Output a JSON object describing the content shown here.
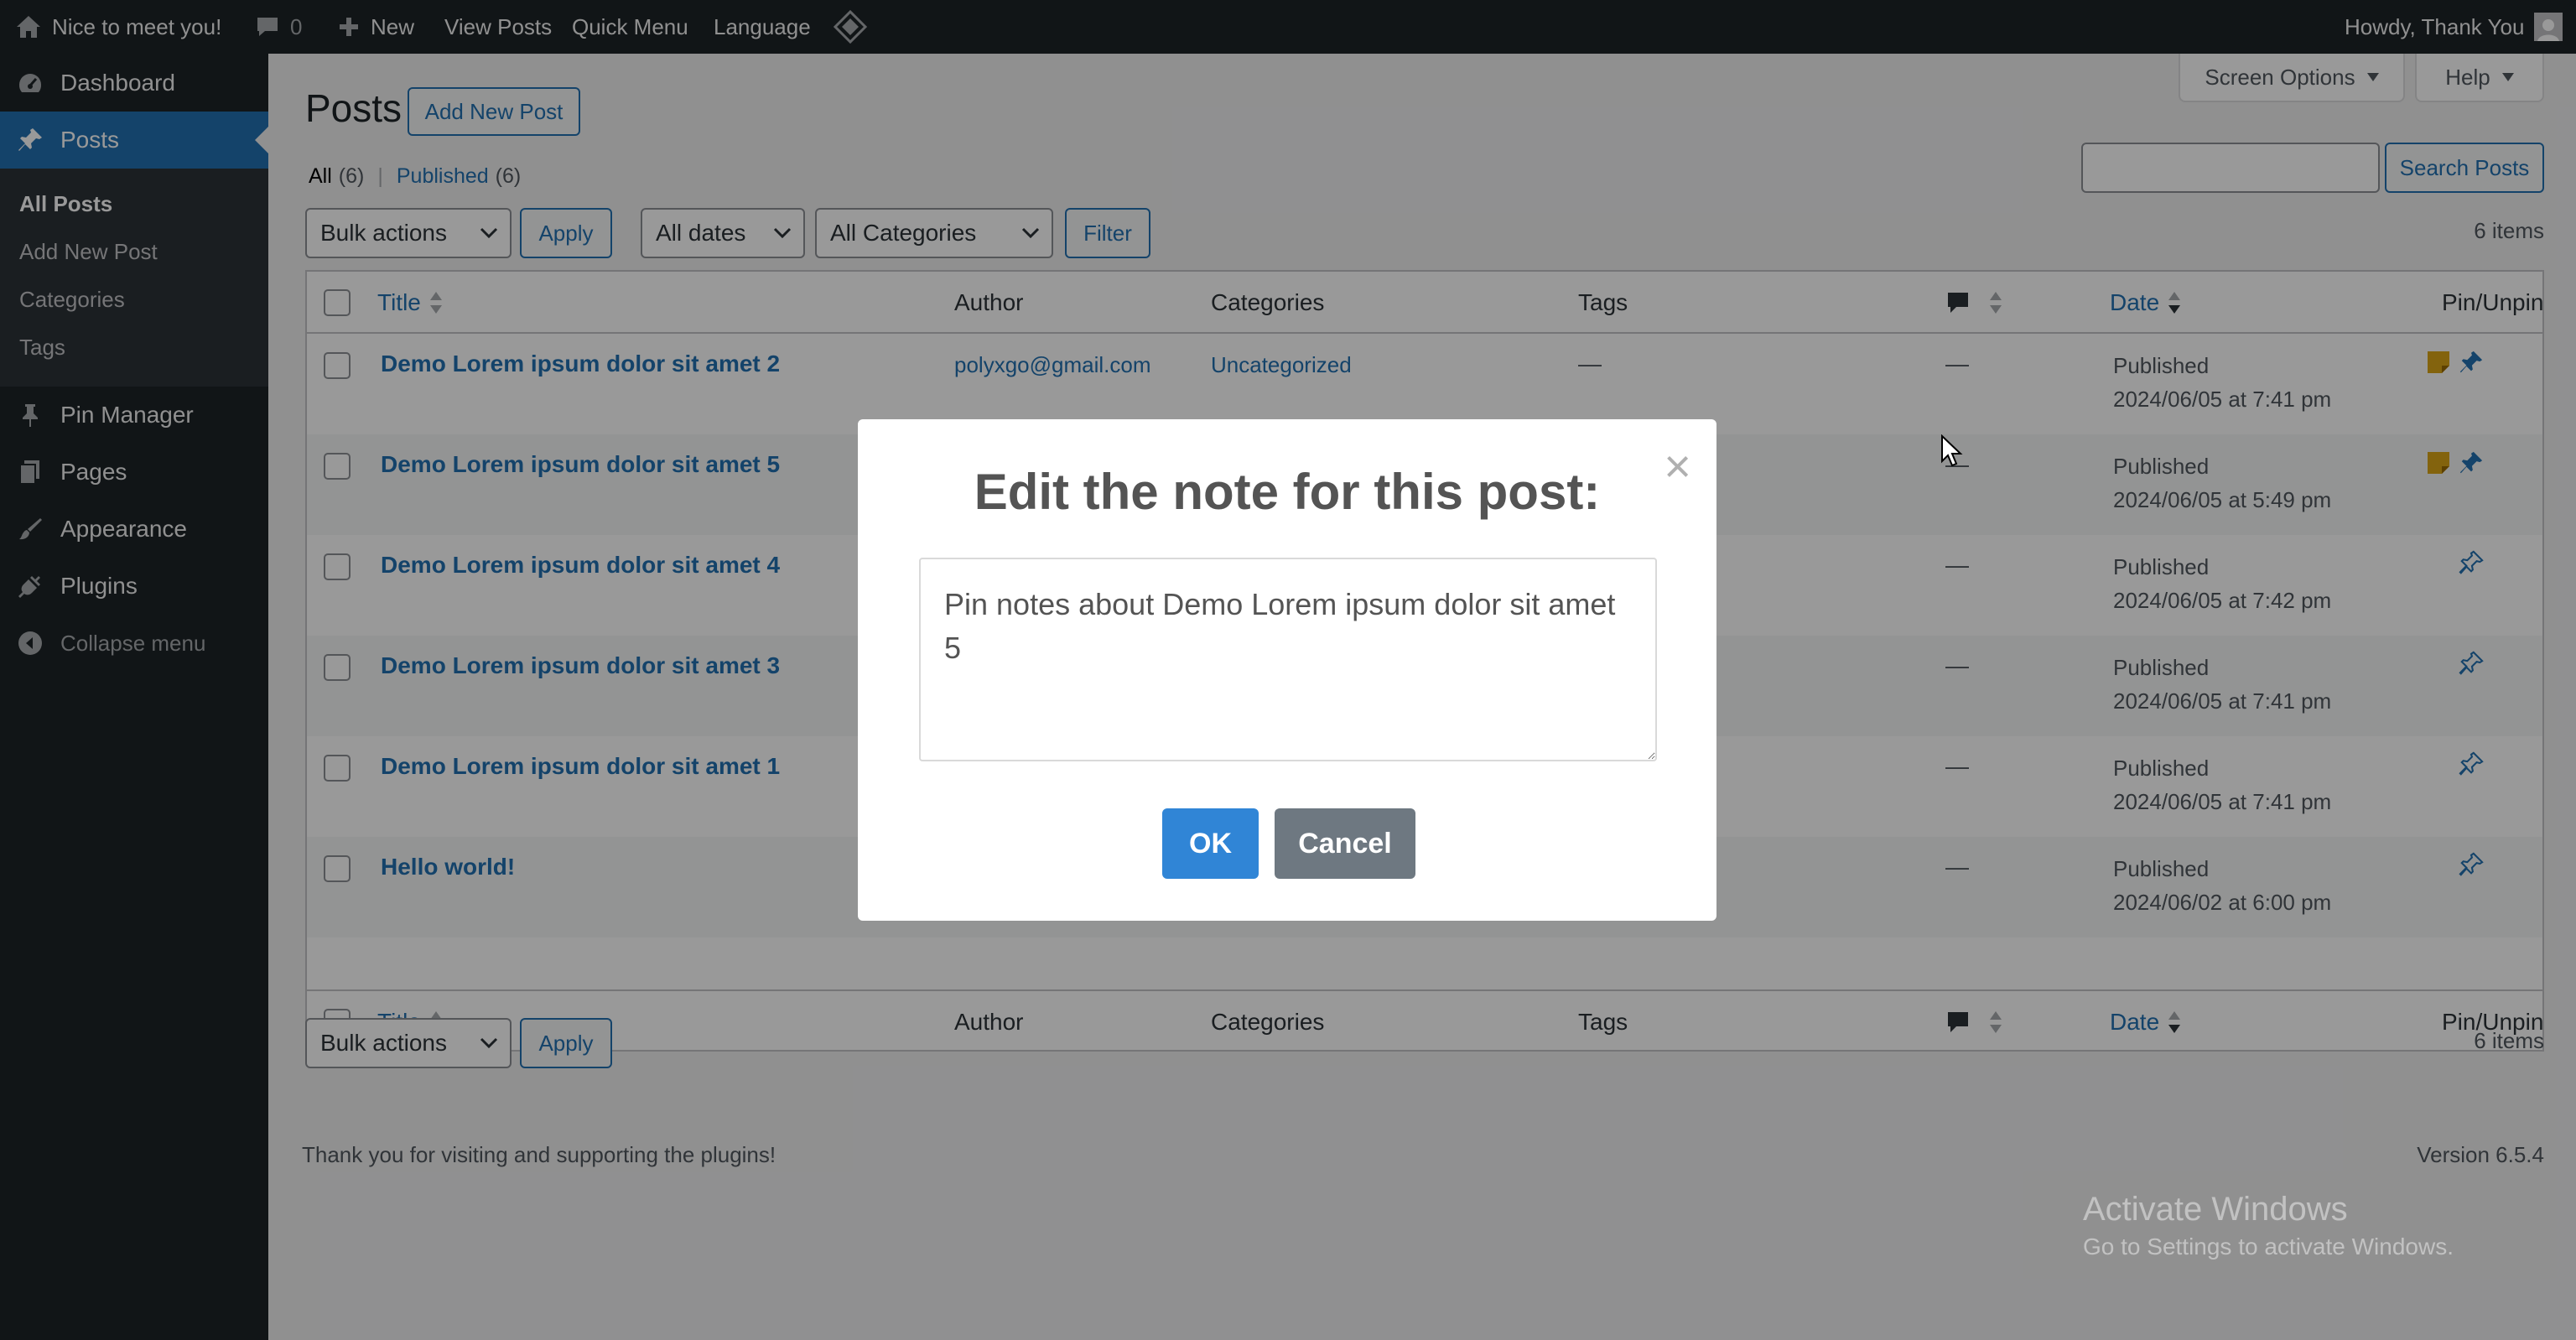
{
  "adminbar": {
    "site_name": "Nice to meet you!",
    "comments_count": "0",
    "new_label": "New",
    "view_posts": "View Posts",
    "quick_menu": "Quick Menu",
    "language": "Language",
    "howdy": "Howdy, Thank You"
  },
  "sidebar": {
    "dashboard": "Dashboard",
    "posts": "Posts",
    "sub": {
      "all_posts": "All Posts",
      "add_new_post": "Add New Post",
      "categories": "Categories",
      "tags": "Tags"
    },
    "pin_manager": "Pin Manager",
    "pages": "Pages",
    "appearance": "Appearance",
    "plugins": "Plugins",
    "collapse": "Collapse menu"
  },
  "header": {
    "title": "Posts",
    "add_new": "Add New Post",
    "screen_options": "Screen Options",
    "help": "Help"
  },
  "filters": {
    "all_label": "All",
    "all_count": "(6)",
    "separator": "|",
    "published_label": "Published",
    "published_count": "(6)",
    "bulk_actions": "Bulk actions",
    "apply": "Apply",
    "all_dates": "All dates",
    "all_categories": "All Categories",
    "filter": "Filter",
    "search_value": "",
    "search_button": "Search Posts",
    "items_count": "6 items"
  },
  "table": {
    "columns": {
      "title": "Title",
      "author": "Author",
      "categories": "Categories",
      "tags": "Tags",
      "date": "Date",
      "pin": "Pin/Unpin"
    },
    "rows": [
      {
        "title": "Demo Lorem ipsum dolor sit amet 2",
        "author": "polyxgo@gmail.com",
        "category": "Uncategorized",
        "tags": "—",
        "comments": "—",
        "status": "Published",
        "date": "2024/06/05 at 7:41 pm",
        "pinned": true
      },
      {
        "title": "Demo Lorem ipsum dolor sit amet 5",
        "author": "",
        "category": "",
        "tags": "",
        "comments": "—",
        "status": "Published",
        "date": "2024/06/05 at 5:49 pm",
        "pinned": true
      },
      {
        "title": "Demo Lorem ipsum dolor sit amet 4",
        "author": "",
        "category": "",
        "tags": "",
        "comments": "—",
        "status": "Published",
        "date": "2024/06/05 at 7:42 pm",
        "pinned": false
      },
      {
        "title": "Demo Lorem ipsum dolor sit amet 3",
        "author": "",
        "category": "",
        "tags": "",
        "comments": "—",
        "status": "Published",
        "date": "2024/06/05 at 7:41 pm",
        "pinned": false
      },
      {
        "title": "Demo Lorem ipsum dolor sit amet 1",
        "author": "",
        "category": "",
        "tags": "",
        "comments": "—",
        "status": "Published",
        "date": "2024/06/05 at 7:41 pm",
        "pinned": false
      },
      {
        "title": "Hello world!",
        "author": "",
        "category": "",
        "tags": "",
        "comments": "—",
        "status": "Published",
        "date": "2024/06/02 at 6:00 pm",
        "pinned": false
      }
    ]
  },
  "footer": {
    "thanks": "Thank you for visiting and supporting the plugins!",
    "version": "Version 6.5.4"
  },
  "modal": {
    "title": "Edit the note for this post:",
    "close": "×",
    "note_value": "Pin notes about Demo Lorem ipsum dolor sit amet 5",
    "ok": "OK",
    "cancel": "Cancel"
  },
  "watermark": {
    "line1": "Activate Windows",
    "line2": "Go to Settings to activate Windows."
  },
  "colors": {
    "admin_dark": "#1d2327",
    "accent": "#2271b1",
    "note_icon": "#dba617",
    "ok_button": "#3085d6",
    "cancel_button": "#6e7881"
  }
}
